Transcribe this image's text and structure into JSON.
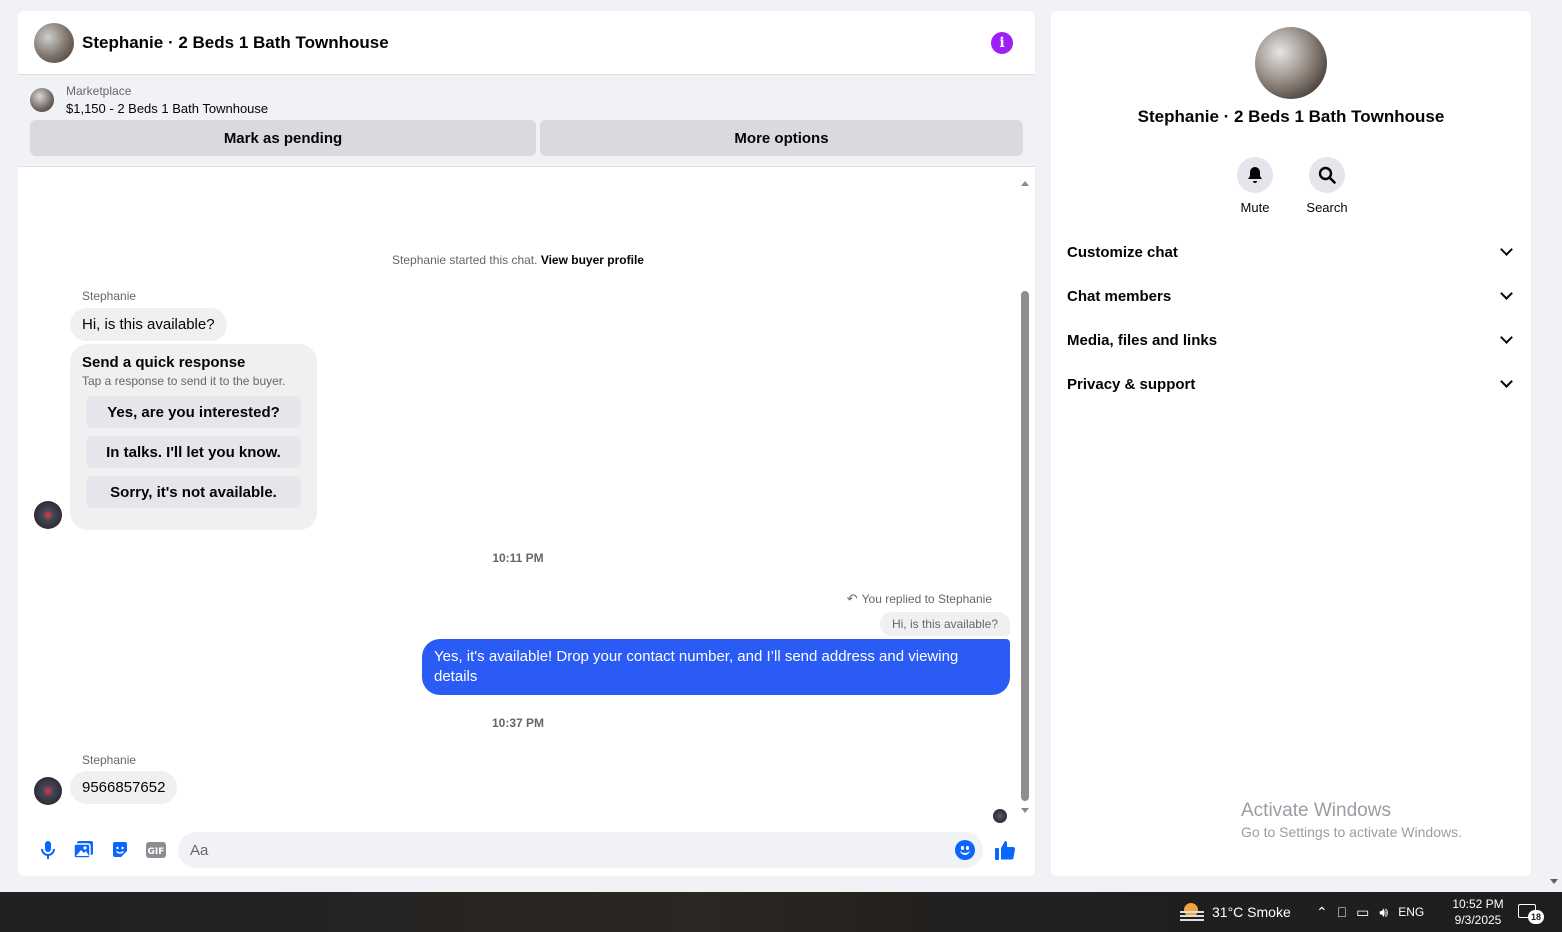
{
  "header": {
    "title": "Stephanie · 2 Beds 1 Bath Townhouse"
  },
  "listing": {
    "source": "Marketplace",
    "price_title": "$1,150 - 2 Beds 1 Bath Townhouse",
    "mark_pending_label": "Mark as pending",
    "more_options_label": "More options"
  },
  "conversation": {
    "system_prefix": "Stephanie started this chat.",
    "view_profile_link": "View buyer profile",
    "messages": [
      {
        "sender": "Stephanie",
        "text": "Hi, is this available?"
      }
    ],
    "quick_response": {
      "title": "Send a quick response",
      "subtitle": "Tap a response to send it to the buyer.",
      "options": [
        "Yes, are you interested?",
        "In talks. I'll let you know.",
        "Sorry, it's not available."
      ]
    },
    "timestamp_1": "10:11 PM",
    "reply_indicator": "You replied to Stephanie",
    "quoted_text": "Hi, is this available?",
    "outgoing_text": "Yes, it's available! Drop your contact number, and I’ll send address and viewing details",
    "timestamp_2": "10:37 PM",
    "second_sender": "Stephanie",
    "second_message": "9566857652"
  },
  "composer": {
    "placeholder": "Aa"
  },
  "details": {
    "title": "Stephanie · 2 Beds 1 Bath Townhouse",
    "actions": [
      {
        "label": "Mute",
        "icon": "bell-icon"
      },
      {
        "label": "Search",
        "icon": "search-icon"
      }
    ],
    "sections": [
      "Customize chat",
      "Chat members",
      "Media, files and links",
      "Privacy & support"
    ]
  },
  "watermark": {
    "line1": "Activate Windows",
    "line2": "Go to Settings to activate Windows."
  },
  "taskbar": {
    "weather": "31°C  Smoke",
    "language": "ENG",
    "time": "10:52 PM",
    "date": "9/3/2025",
    "notification_count": "18"
  },
  "colors": {
    "accent": "#0a66ff",
    "outgoing_bubble": "#2b5bf5",
    "info_icon": "#9c1ff5"
  }
}
